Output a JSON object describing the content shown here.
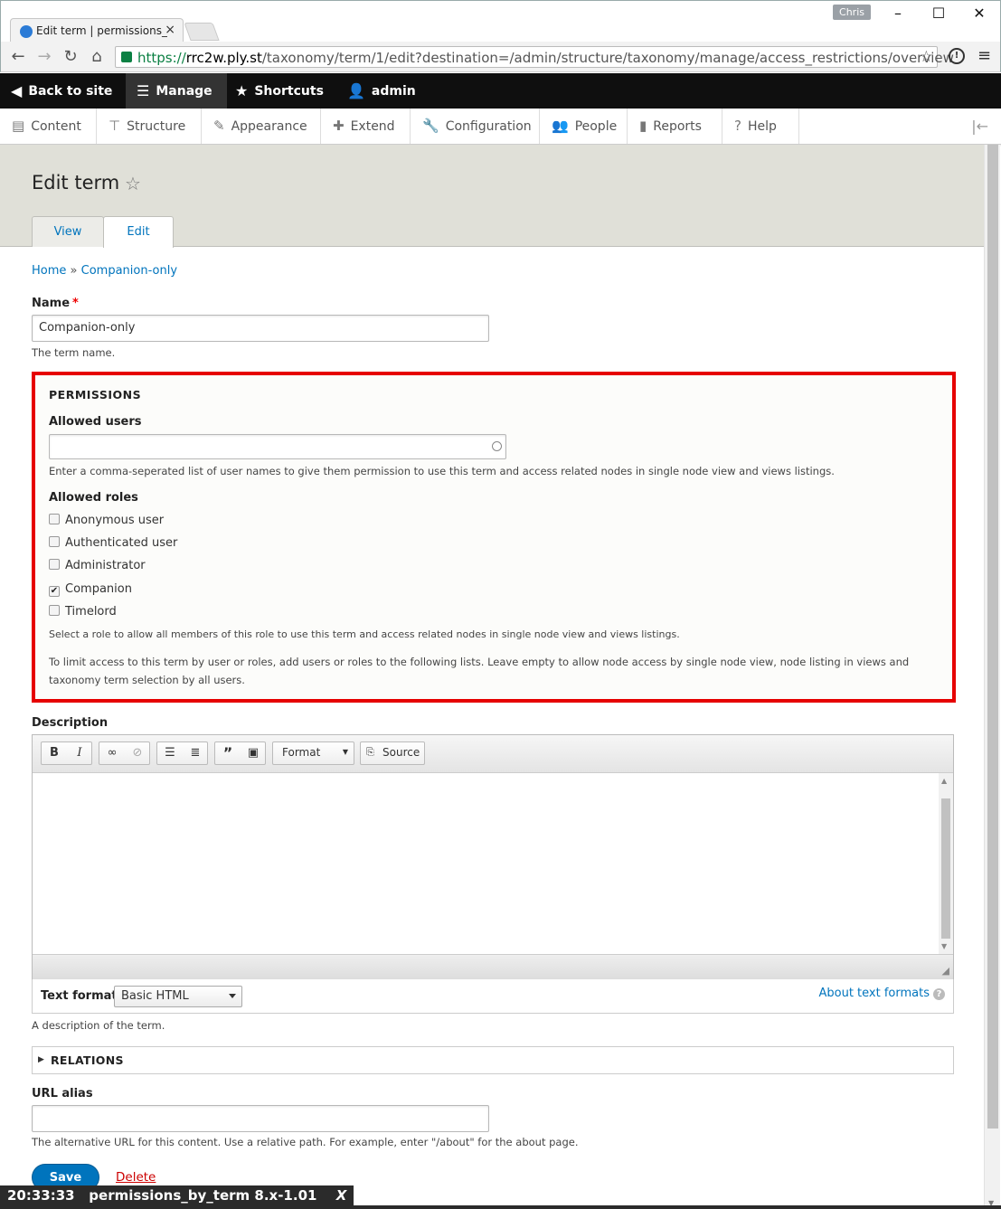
{
  "browser": {
    "tab_title": "Edit term | permissions_by",
    "user": "Chris",
    "url_scheme": "https://",
    "url_host": "rrc2w.ply.st",
    "url_path": "/taxonomy/term/1/edit?destination=/admin/structure/taxonomy/manage/access_restrictions/overview"
  },
  "toolbar": {
    "back": "Back to site",
    "manage": "Manage",
    "shortcuts": "Shortcuts",
    "user": "admin"
  },
  "tray": [
    "Content",
    "Structure",
    "Appearance",
    "Extend",
    "Configuration",
    "People",
    "Reports",
    "Help"
  ],
  "page": {
    "title": "Edit term",
    "tabs": [
      "View",
      "Edit"
    ],
    "breadcrumb_home": "Home",
    "breadcrumb_sep": "»",
    "breadcrumb_current": "Companion-only"
  },
  "name_field": {
    "label": "Name",
    "required": "*",
    "value": "Companion-only",
    "description": "The term name."
  },
  "permissions": {
    "title": "PERMISSIONS",
    "users_label": "Allowed users",
    "users_value": "",
    "users_description": "Enter a comma-seperated list of user names to give them permission to use this term and access related nodes in single node view and views listings.",
    "roles_label": "Allowed roles",
    "roles": [
      {
        "label": "Anonymous user",
        "checked": false
      },
      {
        "label": "Authenticated user",
        "checked": false
      },
      {
        "label": "Administrator",
        "checked": false
      },
      {
        "label": "Companion",
        "checked": true
      },
      {
        "label": "Timelord",
        "checked": false
      }
    ],
    "roles_description": "Select a role to allow all members of this role to use this term and access related nodes in single node view and views listings.",
    "note": "To limit access to this term by user or roles, add users or roles to the following lists. Leave empty to allow node access by single node view, node listing in views and taxonomy term selection by all users."
  },
  "description_field": {
    "label": "Description",
    "format_dropdown": "Format",
    "source_button": "Source",
    "text_format_label": "Text format",
    "text_format_value": "Basic HTML",
    "about_formats": "About text formats",
    "help": "A description of the term."
  },
  "relations": {
    "title": "RELATIONS"
  },
  "url_alias": {
    "label": "URL alias",
    "value": "",
    "description": "The alternative URL for this content. Use a relative path. For example, enter \"/about\" for the about page."
  },
  "actions": {
    "save": "Save",
    "delete": "Delete"
  },
  "overlay": {
    "time": "20:33:33",
    "text": "permissions_by_term 8.x-1.01",
    "close": "X"
  }
}
